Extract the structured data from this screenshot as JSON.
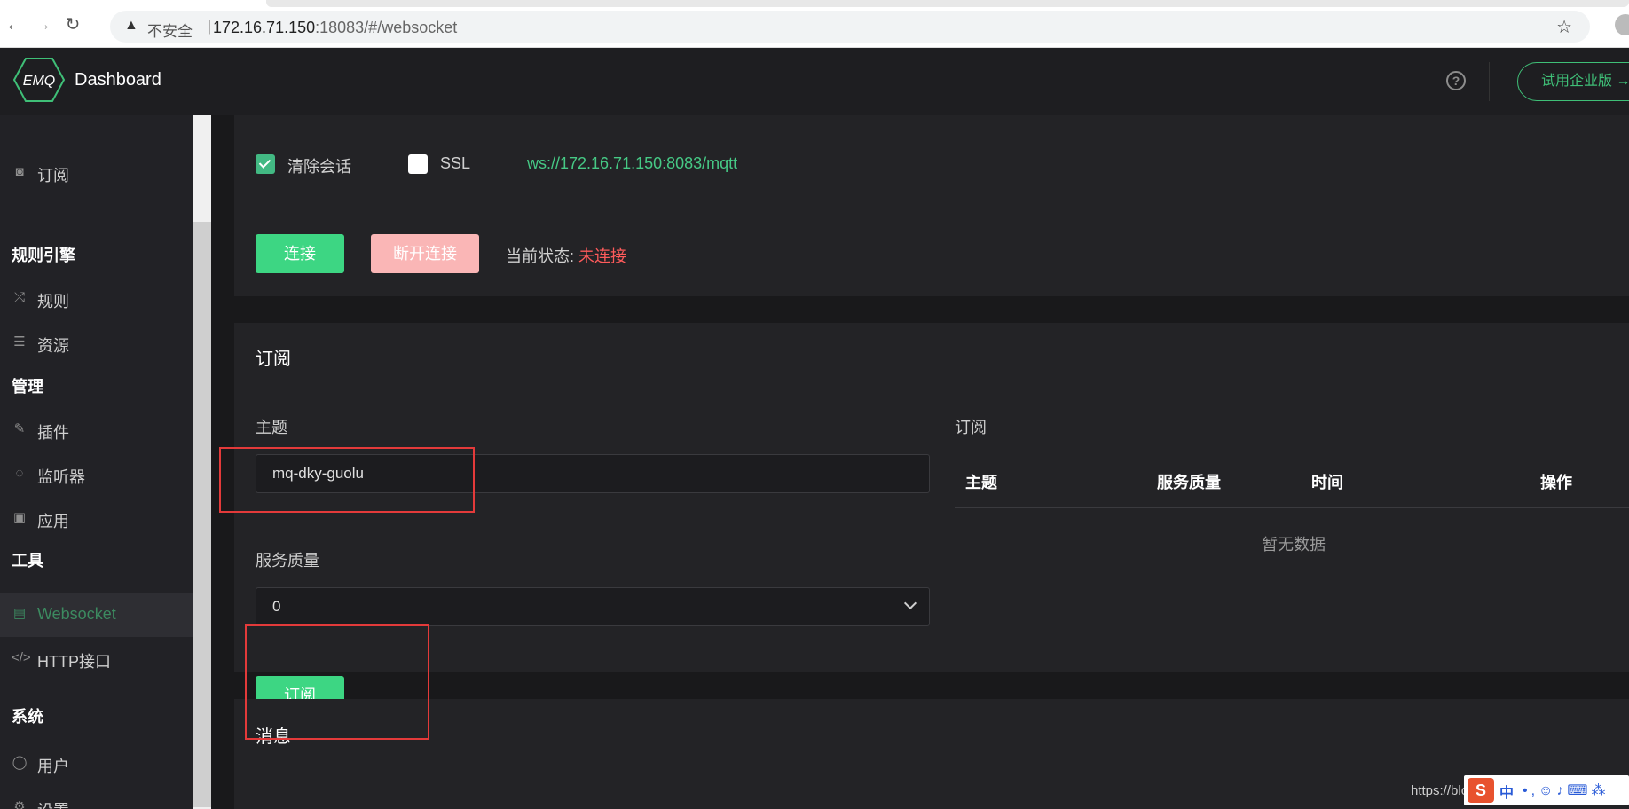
{
  "browser": {
    "back": "←",
    "forward": "→",
    "reload": "↻",
    "insecure_label": "不安全",
    "separator": "|",
    "url_host": "172.16.71.150",
    "url_rest": ":18083/#/websocket",
    "star": "☆"
  },
  "app": {
    "logo_text": "EMQ",
    "title": "Dashboard"
  },
  "header": {
    "help": "?",
    "trial_button": "试用企业版 →"
  },
  "sidebar": {
    "items": [
      {
        "label": "订阅",
        "icon": "rss-icon"
      },
      {
        "label": "规则",
        "icon": "shuffle-icon"
      },
      {
        "label": "资源",
        "icon": "server-icon"
      },
      {
        "label": "插件",
        "icon": "plug-icon"
      },
      {
        "label": "监听器",
        "icon": "radar-icon"
      },
      {
        "label": "应用",
        "icon": "box-icon"
      },
      {
        "label": "Websocket",
        "icon": "html5-icon",
        "active": true
      },
      {
        "label": "HTTP接口",
        "icon": "code-icon"
      },
      {
        "label": "用户",
        "icon": "user-icon"
      },
      {
        "label": "设置",
        "icon": "gear-icon"
      }
    ],
    "sections": [
      "规则引擎",
      "管理",
      "工具",
      "系统"
    ]
  },
  "connection": {
    "clean_session_label": "清除会话",
    "ssl_label": "SSL",
    "ws_url": "ws://172.16.71.150:8083/mqtt",
    "connect_label": "连接",
    "disconnect_label": "断开连接",
    "status_label": "当前状态:",
    "status_value": "未连接"
  },
  "subscribe": {
    "title": "订阅",
    "topic_label": "主题",
    "topic_value": "mq-dky-guolu",
    "qos_label": "服务质量",
    "qos_value": "0",
    "subscribe_button": "订阅",
    "list_title": "订阅",
    "columns": [
      "主题",
      "服务质量",
      "时间",
      "操作"
    ],
    "empty_text": "暂无数据"
  },
  "messages": {
    "title": "消息"
  },
  "footer": {
    "watermark": "https://blo",
    "ime_logo": "S",
    "ime_lang": "中",
    "ime_icons": "•,☺♪⌨⁂"
  },
  "colors": {
    "accent_green": "#3dd683",
    "danger_pink": "#fab6b6",
    "status_red": "#ff5b5b",
    "highlight_red": "#e33a3a"
  }
}
